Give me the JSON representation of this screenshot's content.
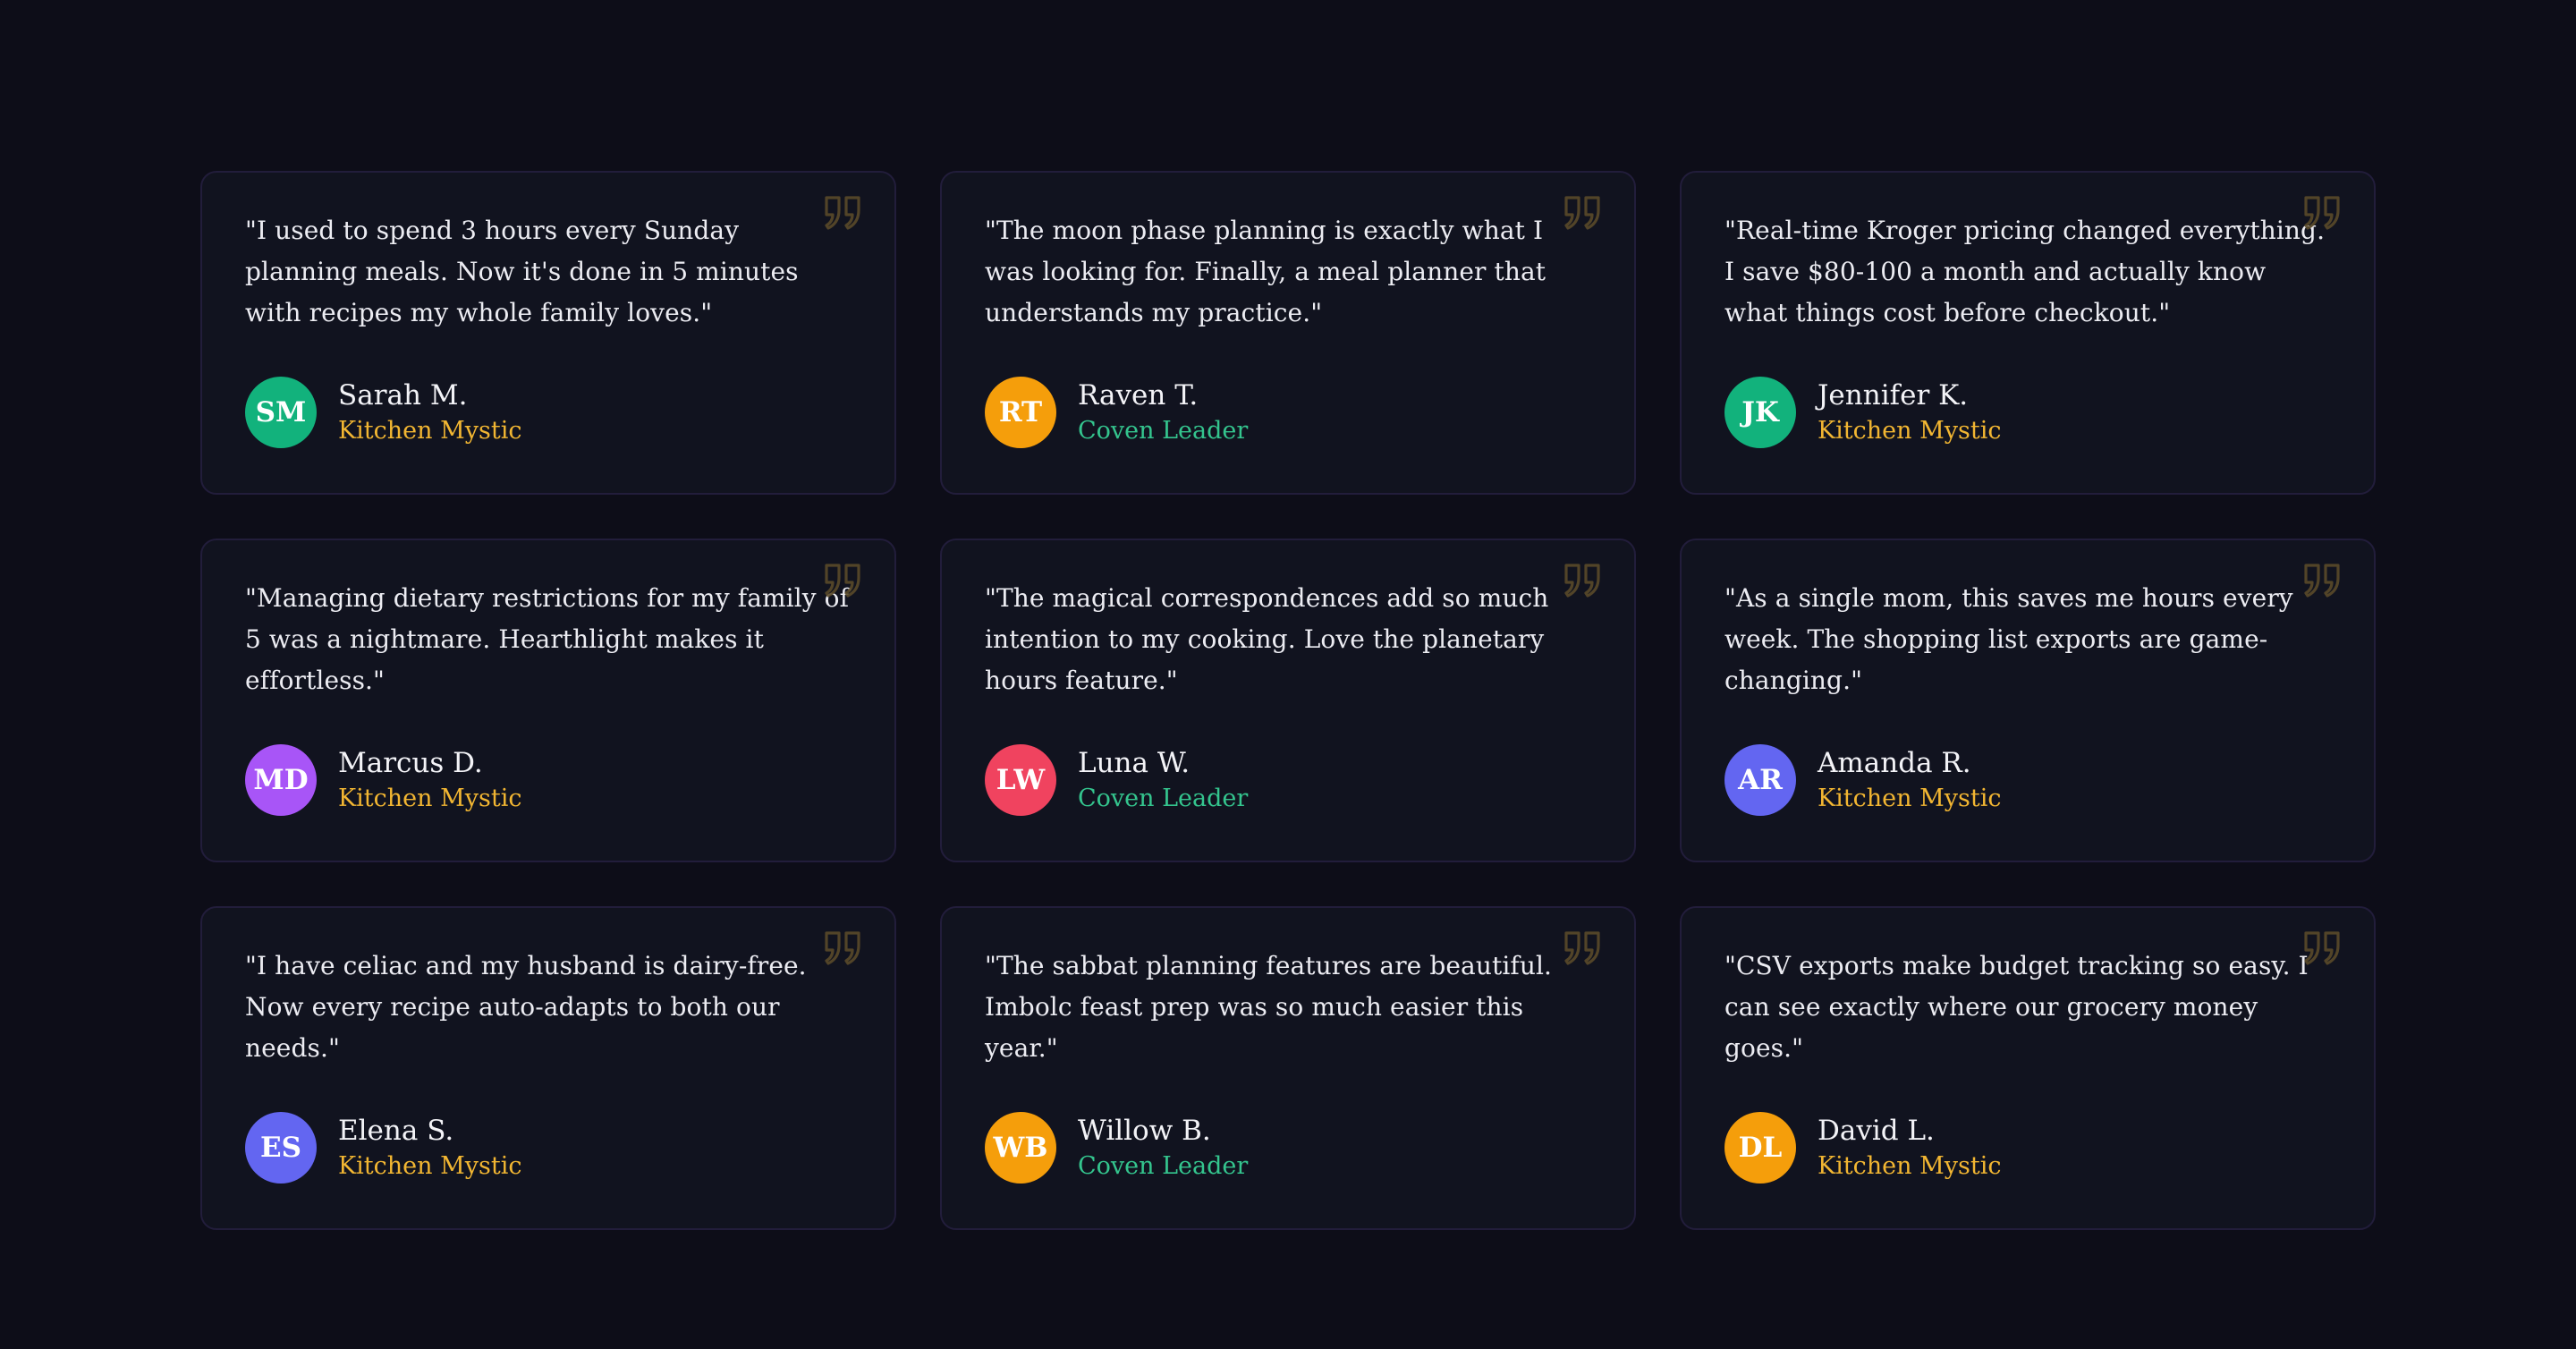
{
  "testimonials": [
    {
      "quote": "\"I used to spend 3 hours every Sunday planning meals. Now it's done in 5 minutes with recipes my whole family loves.\"",
      "initials": "SM",
      "name": "Sarah M.",
      "role": "Kitchen Mystic",
      "avatar_color": "#12b27c",
      "role_color": "#f2b632"
    },
    {
      "quote": "\"The moon phase planning is exactly what I was looking for. Finally, a meal planner that understands my practice.\"",
      "initials": "RT",
      "name": "Raven T.",
      "role": "Coven Leader",
      "avatar_color": "#f59e0b",
      "role_color": "#34c58e"
    },
    {
      "quote": "\"Real-time Kroger pricing changed everything. I save $80-100 a month and actually know what things cost before checkout.\"",
      "initials": "JK",
      "name": "Jennifer K.",
      "role": "Kitchen Mystic",
      "avatar_color": "#12b27c",
      "role_color": "#f2b632"
    },
    {
      "quote": "\"Managing dietary restrictions for my family of 5 was a nightmare. Hearthlight makes it effortless.\"",
      "initials": "MD",
      "name": "Marcus D.",
      "role": "Kitchen Mystic",
      "avatar_color": "#a855f7",
      "role_color": "#f2b632"
    },
    {
      "quote": "\"The magical correspondences add so much intention to my cooking. Love the planetary hours feature.\"",
      "initials": "LW",
      "name": "Luna W.",
      "role": "Coven Leader",
      "avatar_color": "#f0435f",
      "role_color": "#34c58e"
    },
    {
      "quote": "\"As a single mom, this saves me hours every week. The shopping list exports are game-changing.\"",
      "initials": "AR",
      "name": "Amanda R.",
      "role": "Kitchen Mystic",
      "avatar_color": "#6366f1",
      "role_color": "#f2b632"
    },
    {
      "quote": "\"I have celiac and my husband is dairy-free. Now every recipe auto-adapts to both our needs.\"",
      "initials": "ES",
      "name": "Elena S.",
      "role": "Kitchen Mystic",
      "avatar_color": "#6366f1",
      "role_color": "#f2b632"
    },
    {
      "quote": "\"The sabbat planning features are beautiful. Imbolc feast prep was so much easier this year.\"",
      "initials": "WB",
      "name": "Willow B.",
      "role": "Coven Leader",
      "avatar_color": "#f59e0b",
      "role_color": "#34c58e"
    },
    {
      "quote": "\"CSV exports make budget tracking so easy. I can see exactly where our grocery money goes.\"",
      "initials": "DL",
      "name": "David L.",
      "role": "Kitchen Mystic",
      "avatar_color": "#f59e0b",
      "role_color": "#f2b632"
    }
  ],
  "quote_icon": "quote-icon",
  "quote_icon_color": "#5a4a2a"
}
